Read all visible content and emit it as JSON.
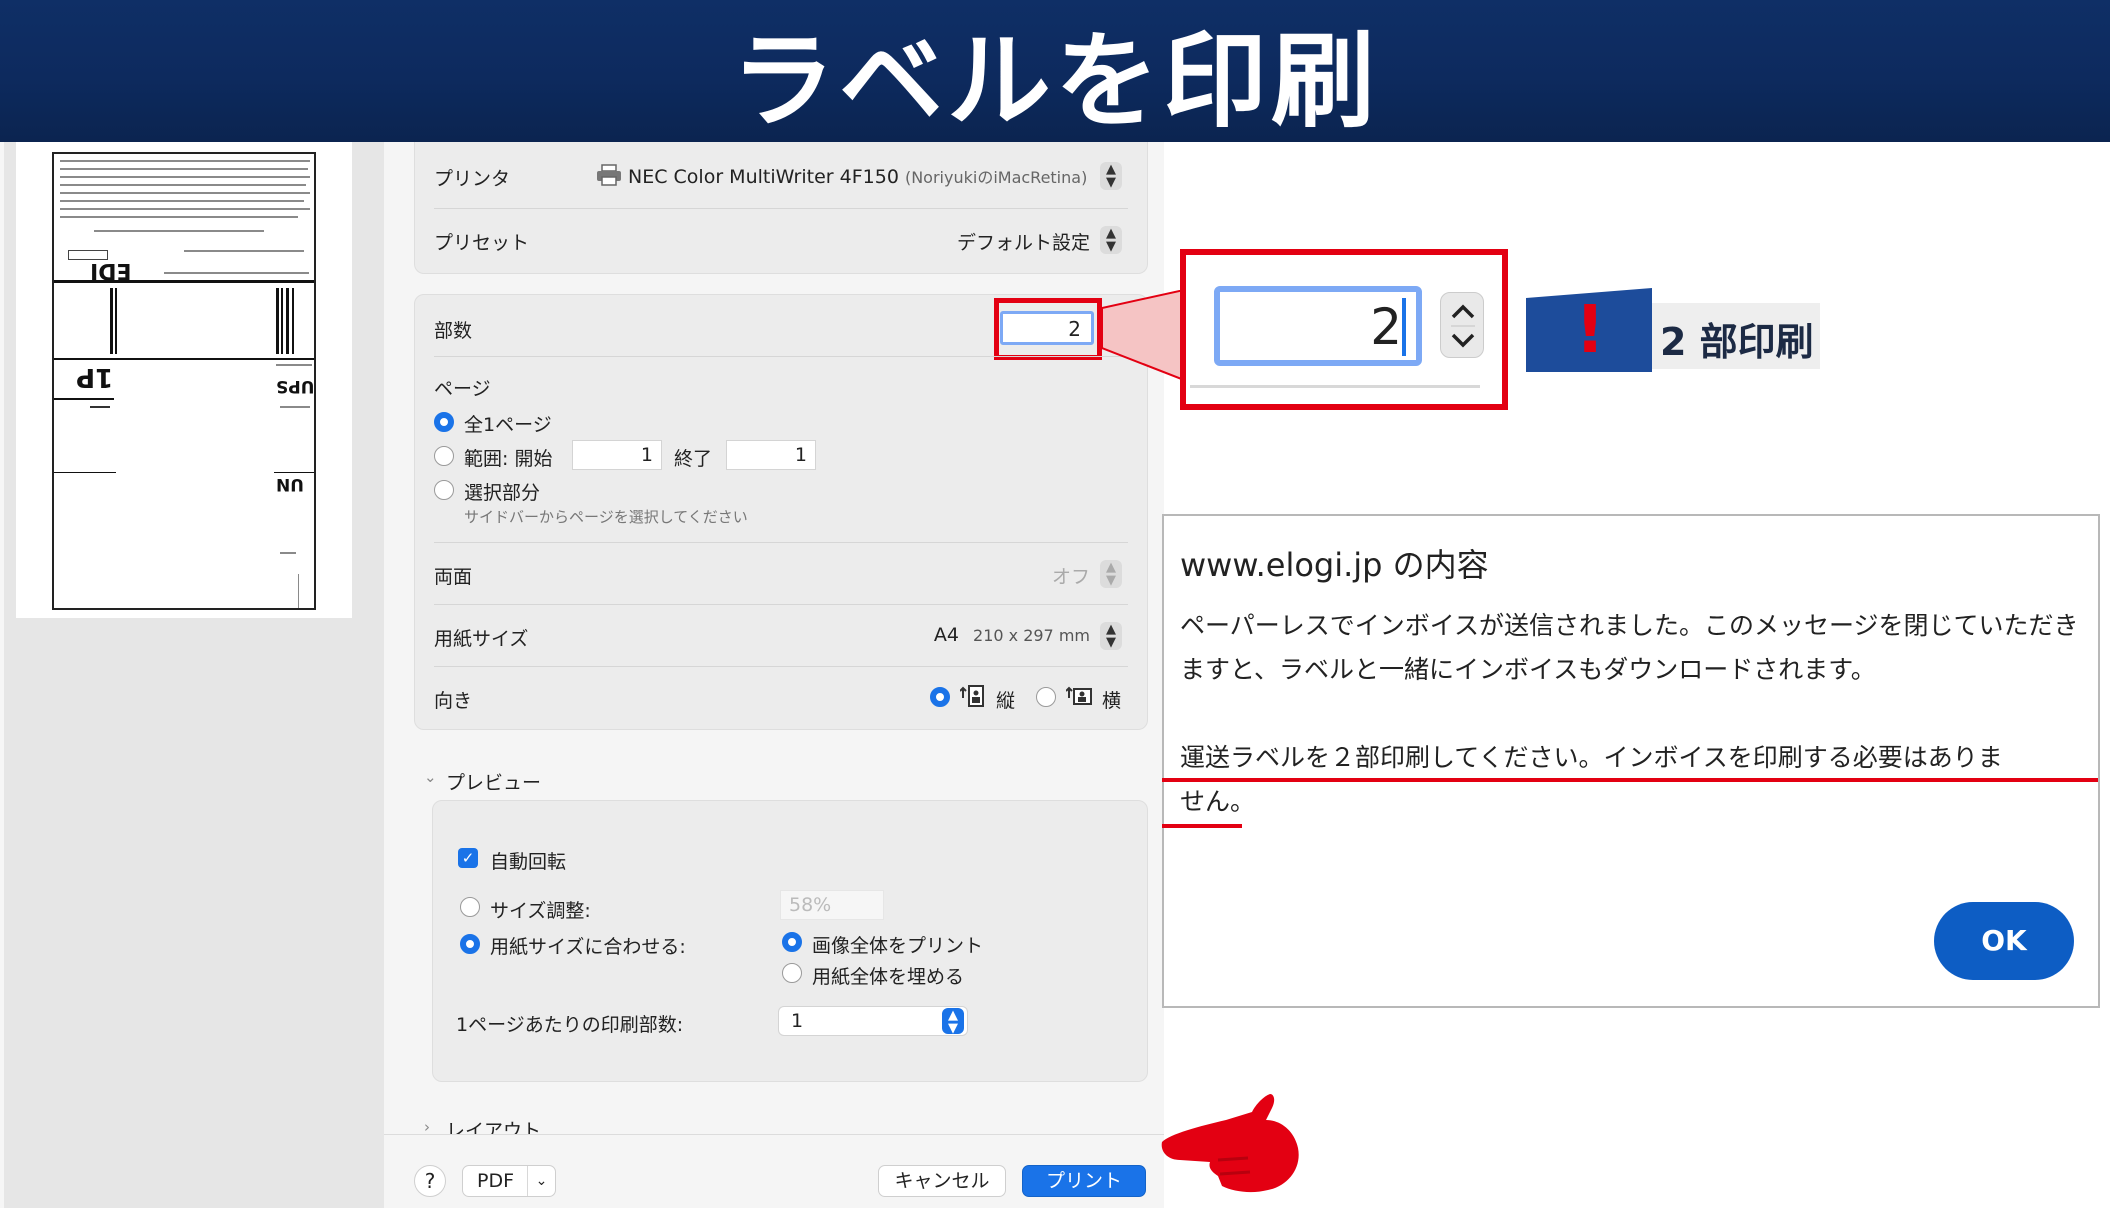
{
  "banner": {
    "title": "ラベルを印刷"
  },
  "printer": {
    "label": "プリンタ",
    "name": "NEC Color MultiWriter 4F150",
    "host": "(NoriyukiのiMacRetina)"
  },
  "preset": {
    "label": "プリセット",
    "value": "デフォルト設定"
  },
  "copies": {
    "label": "部数",
    "value": "2"
  },
  "pages": {
    "label": "ページ",
    "all": "全1ページ",
    "range": "範囲: 開始",
    "range_start": "1",
    "range_end_label": "終了",
    "range_end": "1",
    "selection": "選択部分",
    "selection_hint": "サイドバーからページを選択してください"
  },
  "duplex": {
    "label": "両面",
    "value": "オフ"
  },
  "paper": {
    "label": "用紙サイズ",
    "value": "A4",
    "dims": "210 x 297 mm"
  },
  "orientation": {
    "label": "向き",
    "portrait": "縦",
    "landscape": "横"
  },
  "preview": {
    "section": "プレビュー",
    "auto_rotate": "自動回転",
    "scale": "サイズ調整:",
    "scale_value": "58%",
    "fit": "用紙サイズに合わせる:",
    "print_entire": "画像全体をプリント",
    "fill_paper": "用紙全体を埋める",
    "per_page_label": "1ページあたりの印刷部数:",
    "per_page_value": "1"
  },
  "layout_section": "レイアウト",
  "footer": {
    "help": "?",
    "pdf": "PDF",
    "cancel": "キャンセル",
    "print": "プリント"
  },
  "callout": {
    "copies_zoom": "2",
    "badge_mark": "!",
    "badge_text": "2 部印刷"
  },
  "alert": {
    "title": "www.elogi.jp の内容",
    "message_1": "ペーパーレスでインボイスが送信されました。このメッセージを閉じていただきますと、ラベルと一緒にインボイスもダウンロードされます。",
    "message_2a": "運送ラベルを２部印刷してください。インボイスを印刷する必要はありま",
    "message_2b": "せん。",
    "ok": "OK"
  },
  "colors": {
    "banner": "#0d2a5e",
    "accent": "#1a73e8",
    "highlight": "#e30012",
    "ok": "#0d5dc4"
  }
}
